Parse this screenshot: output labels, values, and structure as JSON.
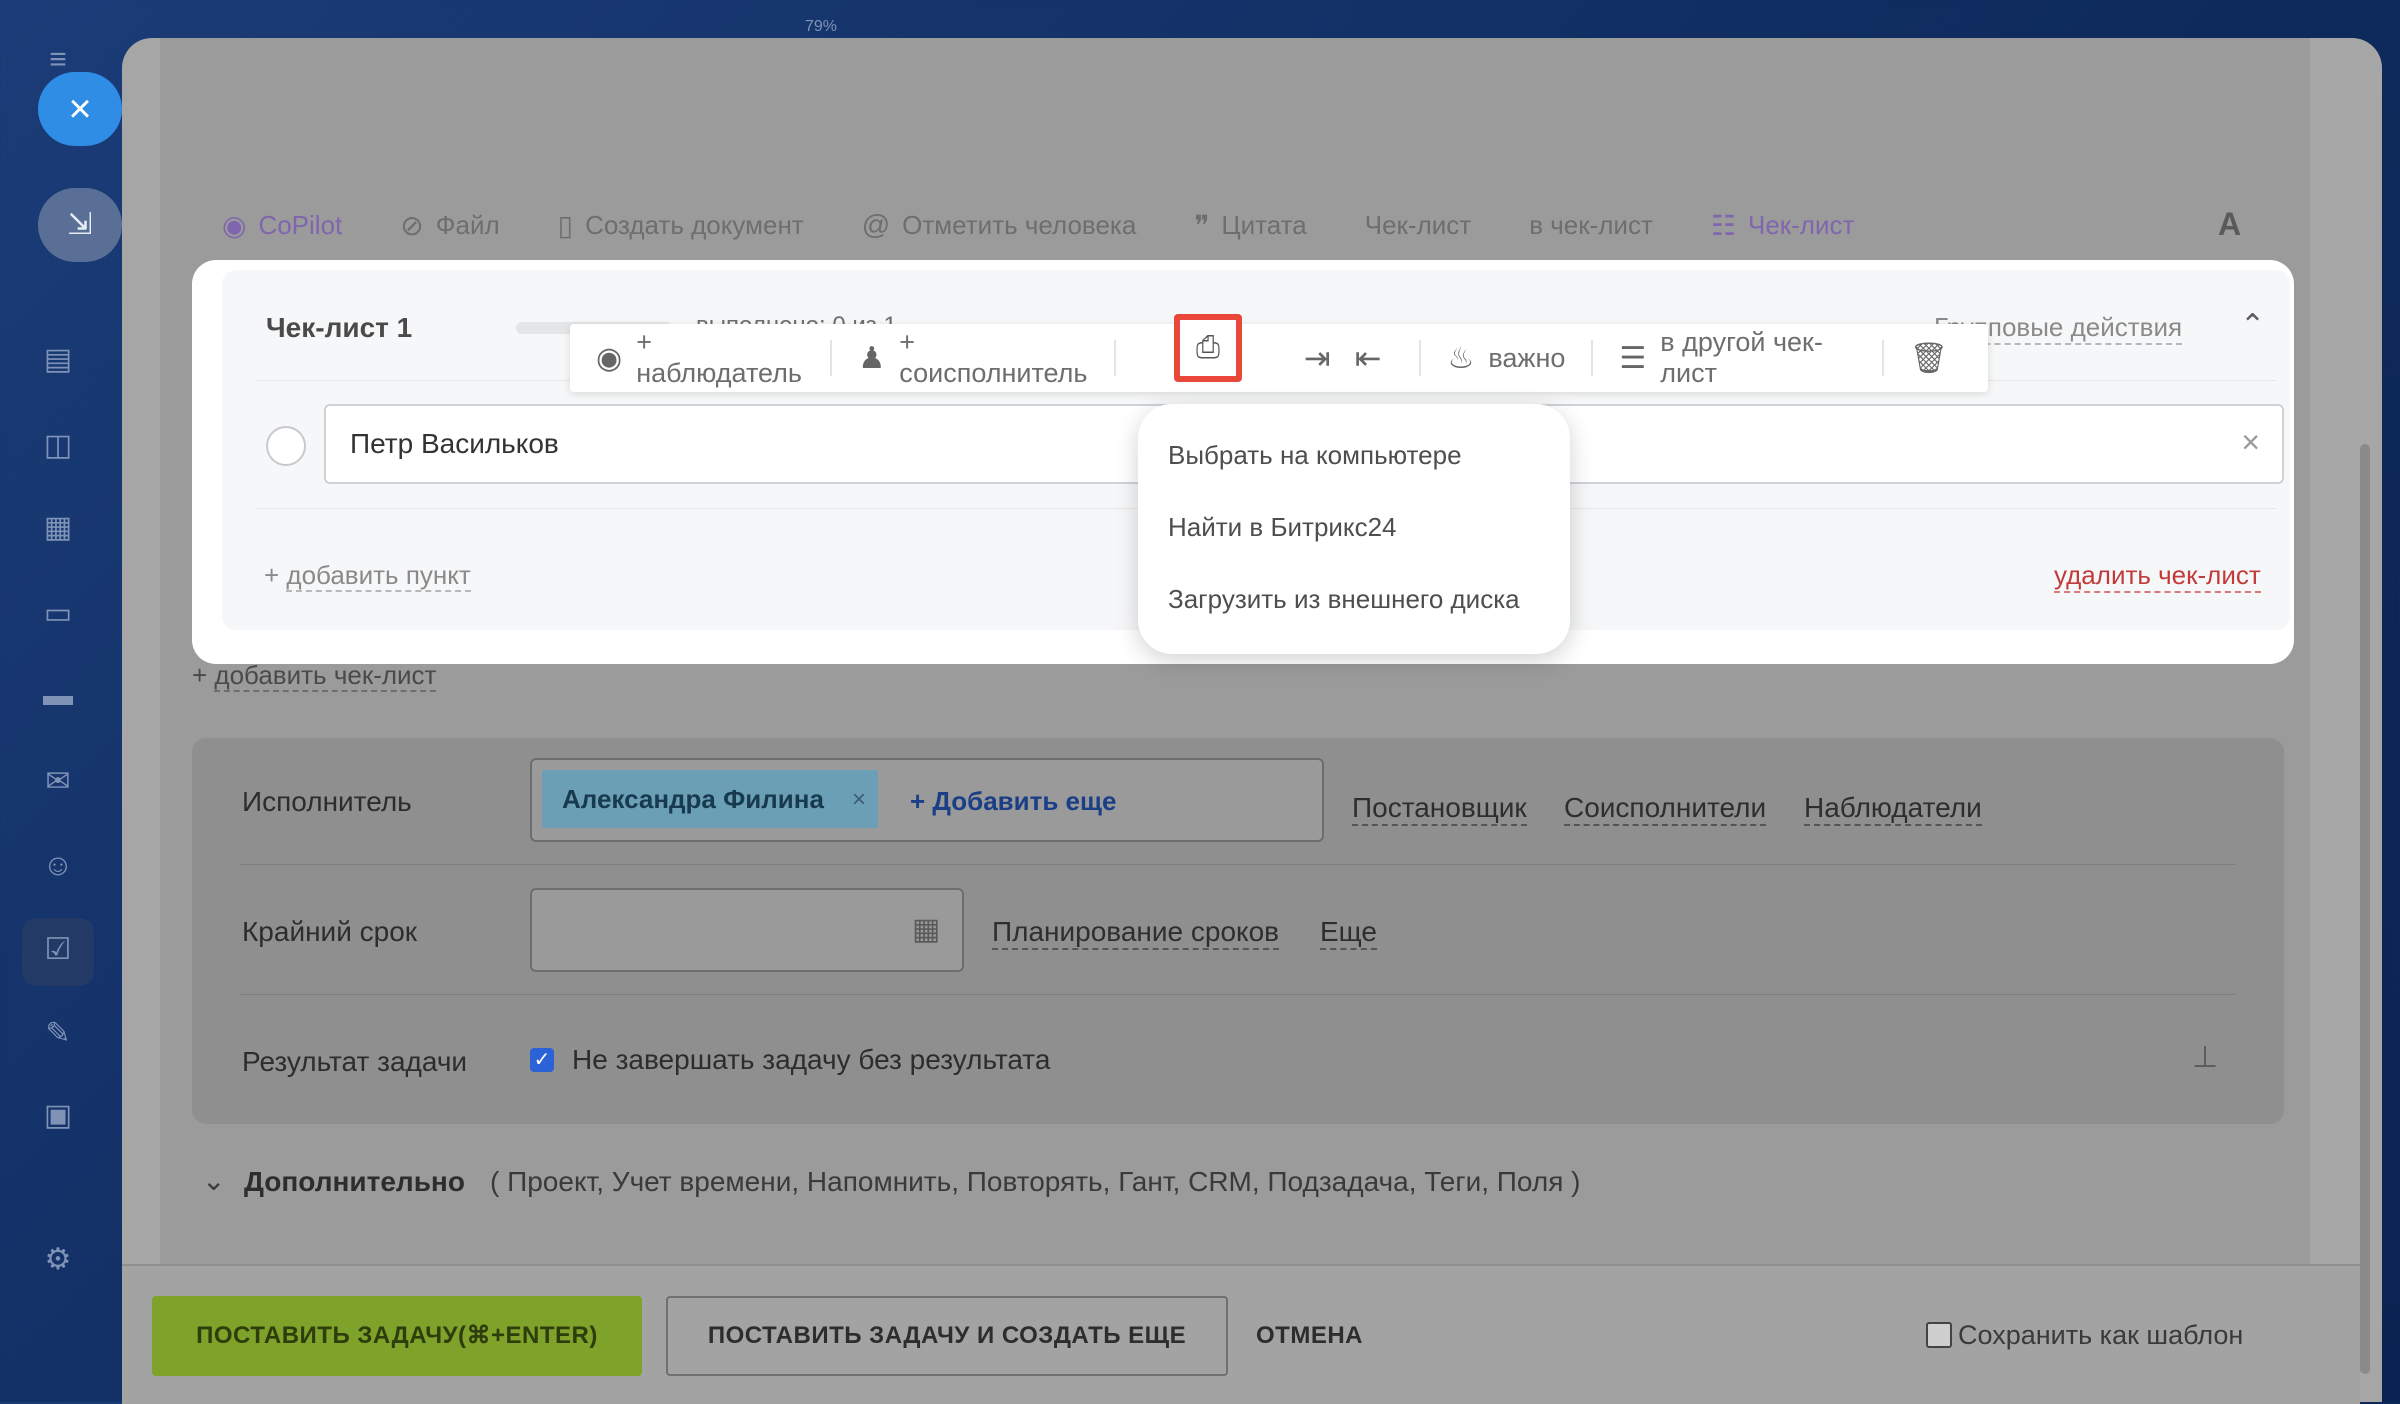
{
  "zoom_label": "79%",
  "sidebar": {
    "close_icon": "×",
    "pin_icon": "⇲"
  },
  "editor_toolbar": {
    "copilot": "CoPilot",
    "file": "Файл",
    "create_doc": "Создать документ",
    "mention": "Отметить человека",
    "quote": "Цитата",
    "checklist": "Чек-лист",
    "to_checklist": "в чек-лист",
    "checklist_add": "Чек-лист",
    "format": "A"
  },
  "checklist": {
    "title": "Чек-лист 1",
    "done_text": "выполнено: 0 из 1",
    "progress": 0,
    "group_actions": "Групповые действия",
    "item_text": "Петр Васильков",
    "add_item_prefix": "+ ",
    "add_item": "добавить пункт",
    "delete": "удалить чек-лист"
  },
  "item_toolbar": {
    "watcher": "+ наблюдатель",
    "coexecutor": "+ соисполнитель",
    "important": "важно",
    "other_checklist": "в другой чек-лист"
  },
  "attach_menu": {
    "options": [
      "Выбрать на компьютере",
      "Найти в Битрикс24",
      "Загрузить из внешнего диска"
    ]
  },
  "add_checklist_prefix": "+ ",
  "add_checklist": "добавить чек-лист",
  "form": {
    "responsible_label": "Исполнитель",
    "responsible_tag": "Александра Филина",
    "add_more": "+ Добавить еще",
    "links": [
      "Постановщик",
      "Соисполнители",
      "Наблюдатели"
    ],
    "deadline_label": "Крайний срок",
    "planning": "Планирование сроков",
    "more": "Еще",
    "result_label": "Результат задачи",
    "result_text": "Не завершать задачу без результата"
  },
  "extra": {
    "title": "Дополнительно",
    "list": "( Проект,   Учет времени,   Напомнить,   Повторять,   Гант,   CRM,   Подзадача,   Теги,   Поля )"
  },
  "footer": {
    "submit": "ПОСТАВИТЬ ЗАДАЧУ(⌘+ENTER)",
    "submit_more": "ПОСТАВИТЬ ЗАДАЧУ И СОЗДАТЬ ЕЩЕ",
    "cancel": "ОТМЕНА",
    "save_template": "Сохранить как шаблон"
  }
}
